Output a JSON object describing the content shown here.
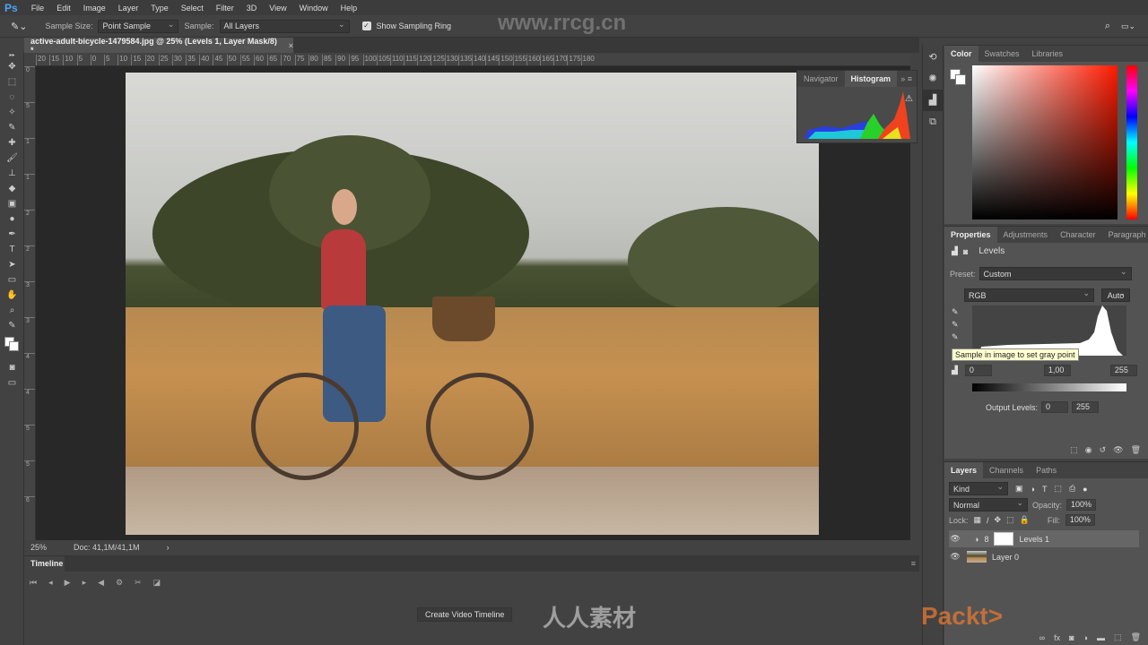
{
  "app": {
    "logo": "Ps",
    "menu": [
      "File",
      "Edit",
      "Image",
      "Layer",
      "Type",
      "Select",
      "Filter",
      "3D",
      "View",
      "Window",
      "Help"
    ]
  },
  "options": {
    "sample_size_label": "Sample Size:",
    "sample_size_value": "Point Sample",
    "sample_label": "Sample:",
    "sample_value": "All Layers",
    "show_ring_label": "Show Sampling Ring",
    "show_ring_checked": true
  },
  "document": {
    "tab_title": "active-adult-bicycle-1479584.jpg @ 25% (Levels 1, Layer Mask/8) *",
    "zoom": "25%",
    "doc_size": "Doc: 41,1M/41,1M"
  },
  "ruler_top": [
    "20",
    "15",
    "10",
    "5",
    "0",
    "5",
    "10",
    "15",
    "20",
    "25",
    "30",
    "35",
    "40",
    "45",
    "50",
    "55",
    "60",
    "65",
    "70",
    "75",
    "80",
    "85",
    "90",
    "95",
    "100",
    "105",
    "110",
    "115",
    "120",
    "125",
    "130",
    "135",
    "140",
    "145",
    "150",
    "155",
    "160",
    "165",
    "170",
    "175",
    "180"
  ],
  "ruler_left": [
    "0",
    "5",
    "1",
    "1",
    "2",
    "2",
    "3",
    "3",
    "4",
    "4",
    "5",
    "5",
    "6"
  ],
  "histogram_panel": {
    "tabs": [
      "Navigator",
      "Histogram"
    ],
    "active": "Histogram"
  },
  "color_panel": {
    "tabs": [
      "Color",
      "Swatches",
      "Libraries"
    ],
    "active": "Color",
    "hue_color": "#ff1a00"
  },
  "properties": {
    "tabs": [
      "Properties",
      "Adjustments",
      "Character",
      "Paragraph"
    ],
    "title": "Levels",
    "preset_label": "Preset:",
    "preset_value": "Custom",
    "channel": "RGB",
    "auto_label": "Auto",
    "tooltip": "Sample in image to set gray point",
    "input_black": "0",
    "input_gamma": "1,00",
    "input_white": "255",
    "output_label": "Output Levels:",
    "output_black": "0",
    "output_white": "255"
  },
  "layers": {
    "tabs": [
      "Layers",
      "Channels",
      "Paths"
    ],
    "filter": "Kind",
    "blend_mode": "Normal",
    "opacity_label": "Opacity:",
    "opacity": "100%",
    "lock_label": "Lock:",
    "fill_label": "Fill:",
    "fill": "100%",
    "items": [
      {
        "name": "Levels 1",
        "selected": true
      },
      {
        "name": "Layer 0",
        "selected": false
      }
    ]
  },
  "timeline": {
    "tab": "Timeline",
    "create_button": "Create Video Timeline"
  },
  "watermark": {
    "site": "www.rrcg.cn",
    "brand": "人人素材",
    "packt": "Packt>"
  }
}
